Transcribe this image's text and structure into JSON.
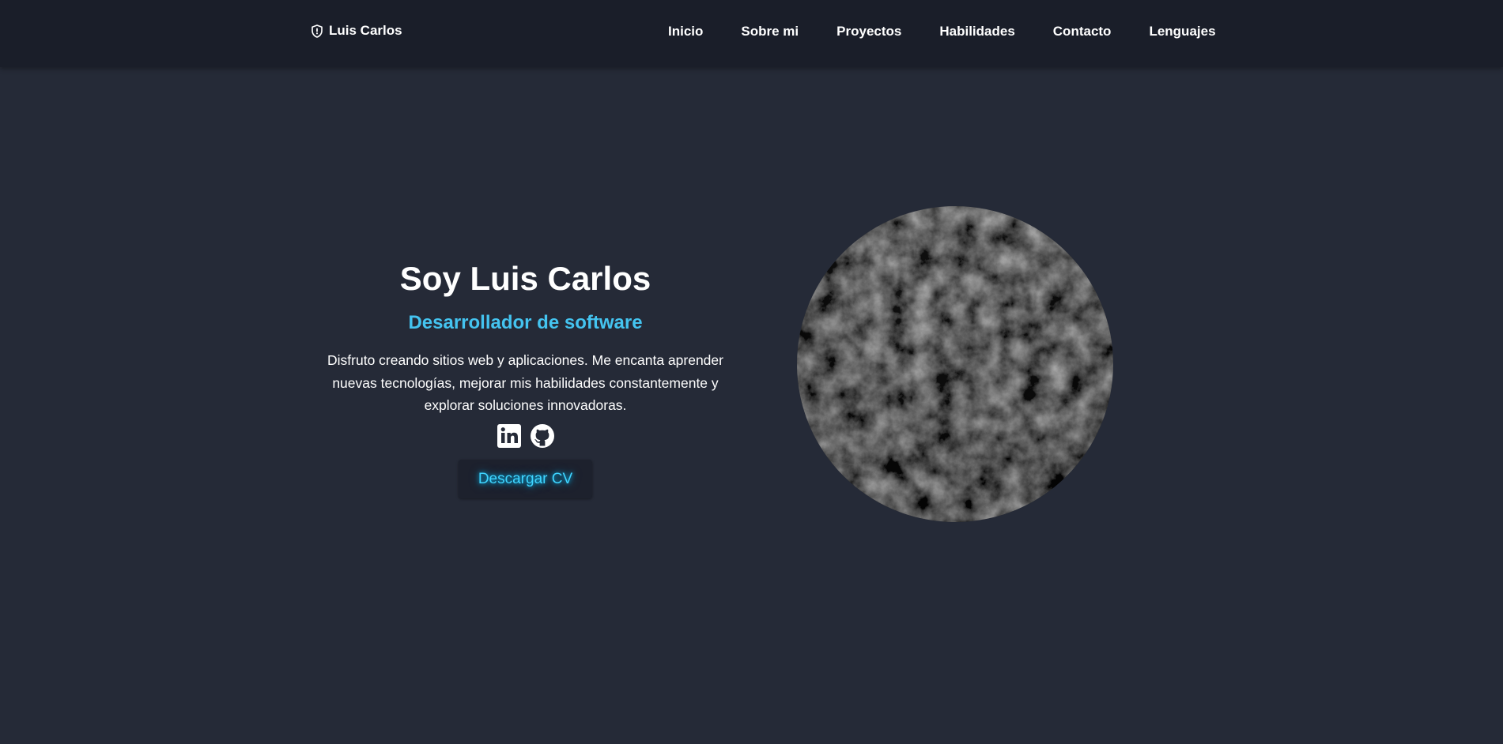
{
  "nav": {
    "brand": "Luis Carlos",
    "brand_icon": "shield-icon",
    "links": [
      {
        "label": "Inicio"
      },
      {
        "label": "Sobre mi"
      },
      {
        "label": "Proyectos"
      },
      {
        "label": "Habilidades"
      },
      {
        "label": "Contacto"
      },
      {
        "label": "Lenguajes"
      }
    ]
  },
  "hero": {
    "title": "Soy Luis Carlos",
    "subtitle": "Desarrollador de software",
    "description": "Disfruto creando sitios web y aplicaciones. Me encanta aprender nuevas tecnologías, mejorar mis habilidades constantemente y explorar soluciones innovadoras.",
    "social": [
      {
        "icon": "linkedin-icon"
      },
      {
        "icon": "github-icon"
      }
    ],
    "cv_button": "Descargar CV"
  },
  "colors": {
    "background": "#252a37",
    "navbar": "#1a1e29",
    "accent": "#44c4f0",
    "button_text": "#3fd4ff"
  }
}
